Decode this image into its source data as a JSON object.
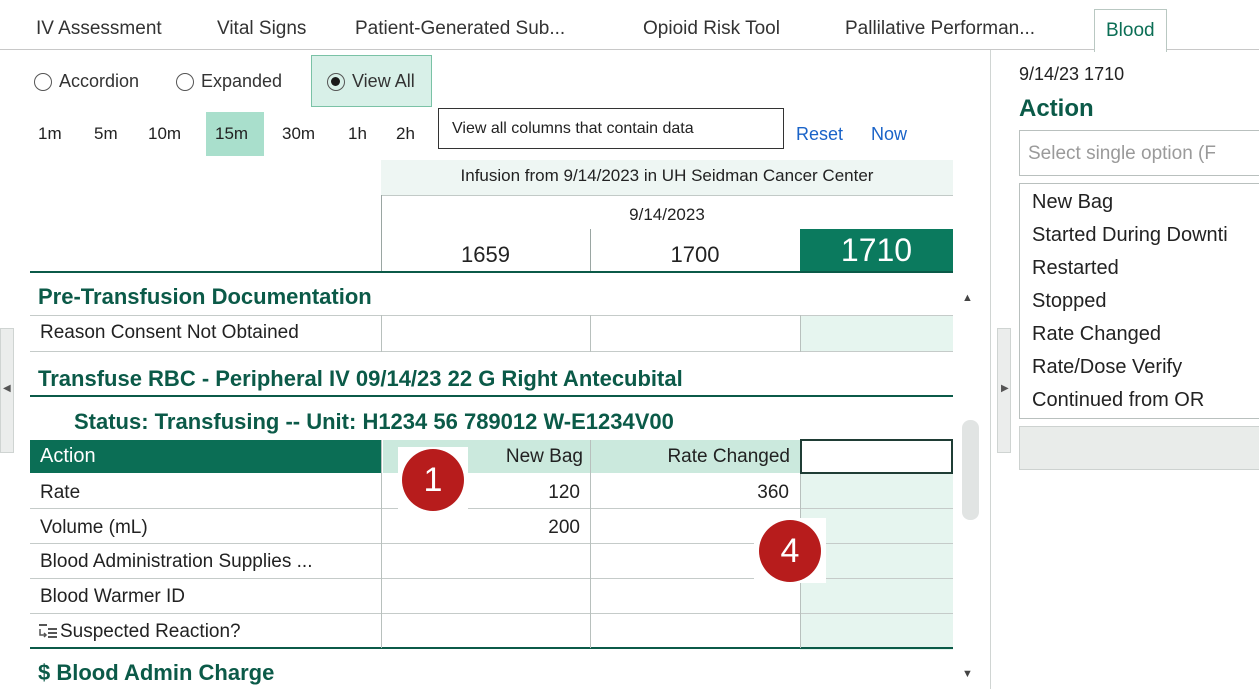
{
  "tabs": [
    "IV Assessment",
    "Vital Signs",
    "Patient-Generated Sub...",
    "Opioid Risk Tool",
    "Pallilative Performan...",
    "Blood"
  ],
  "view_modes": [
    "Accordion",
    "Expanded",
    "View All"
  ],
  "time_intervals": [
    "1m",
    "5m",
    "10m",
    "15m",
    "30m",
    "1h",
    "2h"
  ],
  "tooltip": "View all columns that contain data",
  "links": {
    "reset": "Reset",
    "now": "Now"
  },
  "header": {
    "encounter": "Infusion from 9/14/2023 in UH Seidman Cancer Center",
    "date": "9/14/2023",
    "times": [
      "1659",
      "1700",
      "1710"
    ]
  },
  "sections": {
    "pre_transfusion": "Pre-Transfusion Documentation",
    "reason_consent": "Reason Consent Not Obtained",
    "transfuse": "Transfuse RBC - Peripheral IV 09/14/23 22 G Right Antecubital",
    "status": "Status: Transfusing -- Unit: H1234 56 789012 W-E1234V00",
    "blood_admin_charge": "$ Blood Admin Charge"
  },
  "grid": {
    "action_label": "Action",
    "action_values": [
      "New Bag",
      "Rate Changed",
      ""
    ],
    "rows": [
      {
        "label": "Rate",
        "values": [
          "120",
          "360",
          ""
        ]
      },
      {
        "label": "Volume (mL)",
        "values": [
          "200",
          "",
          ""
        ]
      },
      {
        "label": "Blood Administration Supplies ...",
        "values": [
          "",
          "",
          ""
        ]
      },
      {
        "label": "Blood Warmer ID",
        "values": [
          "",
          "",
          ""
        ]
      },
      {
        "label": "Suspected Reaction?",
        "values": [
          "",
          "",
          ""
        ]
      }
    ]
  },
  "badges": [
    "1",
    "4"
  ],
  "right_panel": {
    "timestamp": "9/14/23 1710",
    "heading": "Action",
    "select_placeholder": "Select single option (F",
    "options": [
      "New Bag",
      "Started During Downti",
      "Restarted",
      "Stopped",
      "Rate Changed",
      "Rate/Dose Verify",
      "Continued from OR"
    ]
  },
  "colors": {
    "accent": "#0b6e55",
    "highlight": "#a9dfcc",
    "badge": "#b71c1c",
    "link": "#1a63c8"
  }
}
